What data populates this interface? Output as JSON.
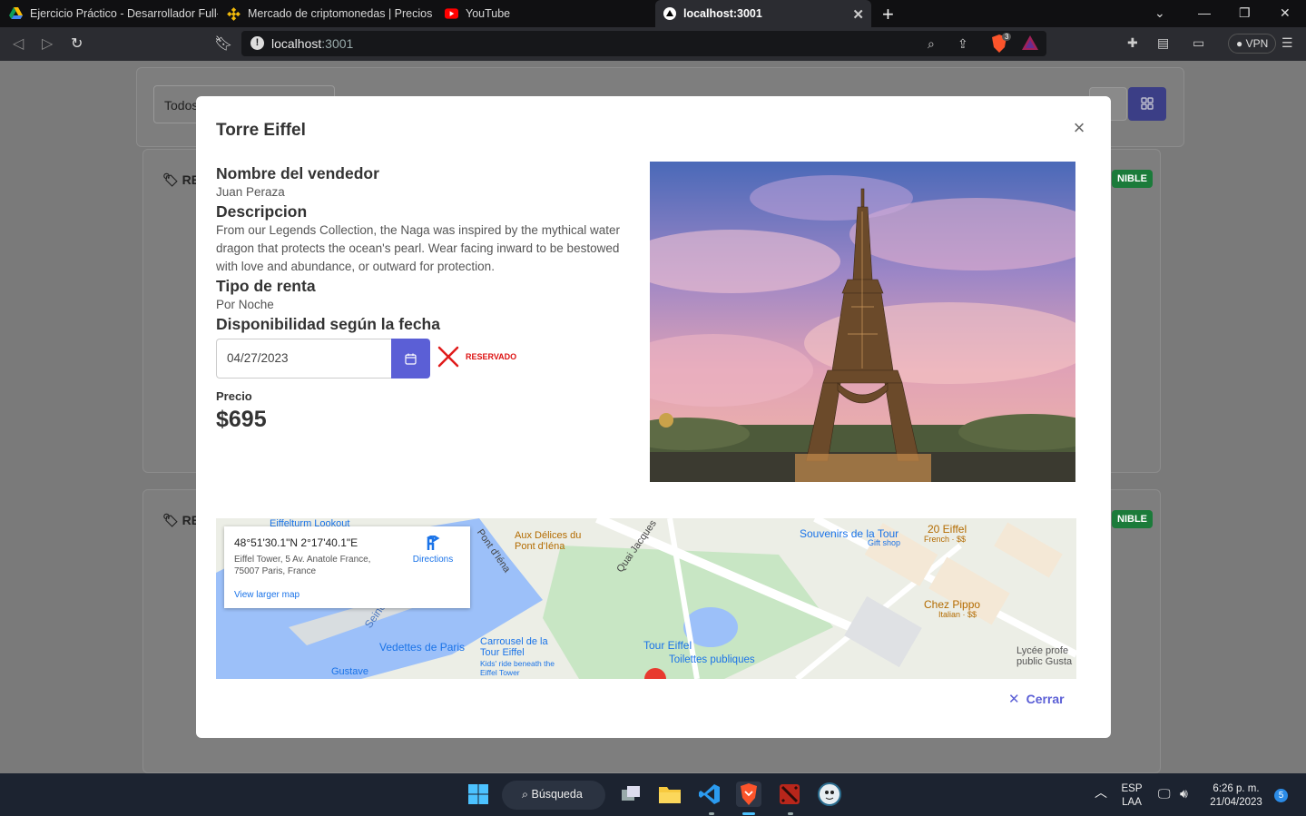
{
  "browser": {
    "tabs": [
      {
        "title": "Ejercicio Práctico - Desarrollador Full-s",
        "icon": "drive-icon"
      },
      {
        "title": "Mercado de criptomonedas | Precios y",
        "icon": "binance-icon"
      },
      {
        "title": "YouTube",
        "icon": "youtube-icon"
      },
      {
        "title": "localhost:3001",
        "icon": "vercel-icon",
        "active": true
      }
    ],
    "url_host": "localhost",
    "url_port": ":3001",
    "vpn_label": "VPN",
    "shield_count": "3"
  },
  "background": {
    "filter_select": "Todos",
    "tag_label": "RE",
    "badge": "NIBLE"
  },
  "modal": {
    "title": "Torre Eiffel",
    "seller_label": "Nombre del vendedor",
    "seller_name": "Juan Peraza",
    "description_label": "Descripcion",
    "description": "From our Legends Collection, the Naga was inspired by the mythical water dragon that protects the ocean's pearl. Wear facing inward to be bestowed with love and abundance, or outward for protection.",
    "rent_type_label": "Tipo de renta",
    "rent_type": "Por Noche",
    "availability_label": "Disponibilidad según la fecha",
    "date_value": "04/27/2023",
    "status": "RESERVADO",
    "status_color": "#dd1111",
    "price_label": "Precio",
    "price": "$695",
    "close_label": "Cerrar",
    "accent_color": "#5b5fd6"
  },
  "map": {
    "coordinates": "48°51'30.1\"N 2°17'40.1\"E",
    "address": "Eiffel Tower, 5 Av. Anatole France, 75007 Paris, France",
    "directions_label": "Directions",
    "larger_map_label": "View larger map",
    "places": [
      "Eiffelturm Lookout",
      "Aux Délices du Pont d'Iéna",
      "Pont d'Iéna",
      "Quai Jacques",
      "Souvenirs de la Tour",
      "Gift shop",
      "20 Eiffel",
      "French · $$",
      "Chez Pippo",
      "Italian · $$",
      "Vedettes de Paris",
      "Carrousel de la Tour Eiffel",
      "Kids' ride beneath the Eiffel Tower",
      "Tour Eiffel",
      "Toilettes publiques",
      "Lycée profe public Gusta",
      "Gustave",
      "Seine"
    ]
  },
  "taskbar": {
    "search_label": "Búsqueda",
    "lang_top": "ESP",
    "lang_bottom": "LAA",
    "time": "6:26 p. m.",
    "date": "21/04/2023",
    "notifications": "5"
  }
}
